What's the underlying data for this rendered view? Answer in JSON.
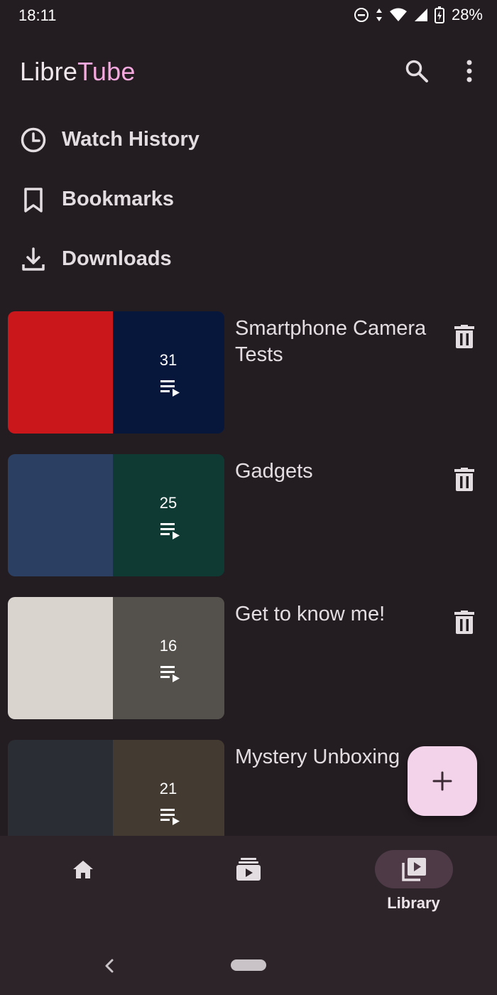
{
  "status": {
    "time": "18:11",
    "battery": "28%"
  },
  "app": {
    "title_part1": "Libre",
    "title_part2": "Tube"
  },
  "menu": [
    {
      "label": "Watch History",
      "icon": "clock-icon"
    },
    {
      "label": "Bookmarks",
      "icon": "bookmark-icon"
    },
    {
      "label": "Downloads",
      "icon": "download-icon"
    }
  ],
  "playlists": [
    {
      "title": "Smartphone Camera Tests",
      "count": "31",
      "colors": [
        "#c9171c",
        "#0e2a6e"
      ]
    },
    {
      "title": "Gadgets",
      "count": "25",
      "colors": [
        "#2b3f62",
        "#1b6b5e"
      ]
    },
    {
      "title": "Get to know me!",
      "count": "16",
      "colors": [
        "#d9d4cd",
        "#9a938b"
      ]
    },
    {
      "title": "Mystery Unboxing",
      "count": "21",
      "colors": [
        "#2a2d33",
        "#7b6a5a"
      ]
    }
  ],
  "nav": [
    {
      "label": "",
      "icon": "home-icon"
    },
    {
      "label": "",
      "icon": "subscriptions-icon"
    },
    {
      "label": "Library",
      "icon": "library-icon"
    }
  ],
  "colors": {
    "background": "#231c21",
    "accent": "#f5a9df",
    "fab": "#f3d3e9",
    "nav_selected": "#4e3a47"
  }
}
